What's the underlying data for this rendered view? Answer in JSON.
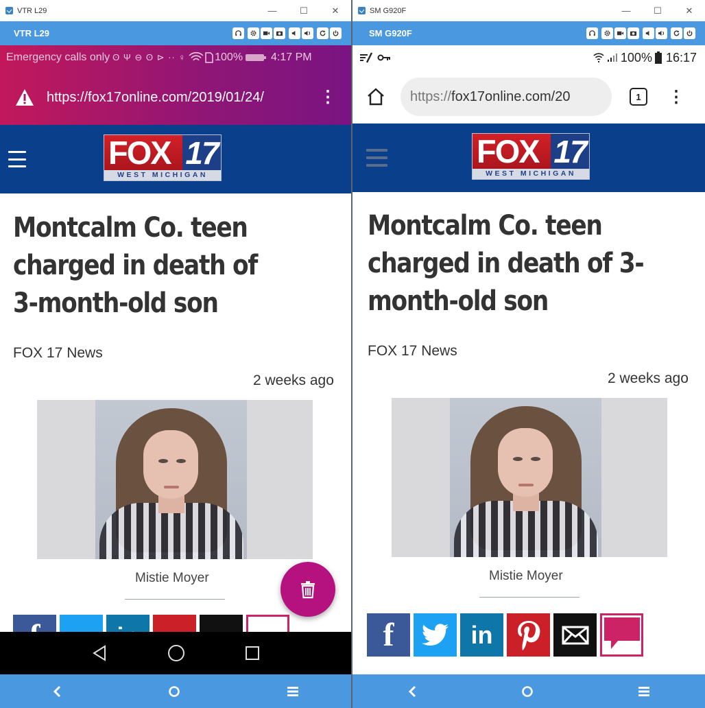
{
  "left": {
    "window_title": "VTR L29",
    "toolbar_title": "VTR L29",
    "status": {
      "text": "Emergency calls only",
      "icons_text": "ʘ Ψ ⊖ ʘ ⊳ ·· ♀",
      "battery": "100%",
      "time": "4:17 PM"
    },
    "url": "https://fox17online.com/2019/01/24/",
    "fab_icon": "delete-icon"
  },
  "right": {
    "window_title": "SM G920F",
    "toolbar_title": "SM G920F",
    "status": {
      "battery": "100%",
      "time": "16:17"
    },
    "url_scheme": "https://",
    "url_rest": "fox17online.com/20",
    "tab_count": "1"
  },
  "site": {
    "logo_text": "FOX",
    "logo_number": "17",
    "logo_sub": "WEST MICHIGAN"
  },
  "article": {
    "headline_left": [
      "Montcalm Co. teen",
      "charged in death of",
      "3-month-old son"
    ],
    "headline_right": [
      "Montcalm Co. teen",
      "charged in death of 3-",
      "month-old son"
    ],
    "byline": "FOX 17 News",
    "time_ago": "2 weeks ago",
    "photo_caption": "Mistie Moyer"
  },
  "share_icons": [
    "facebook-icon",
    "twitter-icon",
    "linkedin-icon",
    "pinterest-icon",
    "email-icon",
    "comment-icon"
  ],
  "share_labels": {
    "facebook": "f",
    "linkedin": "in"
  },
  "window_controls": {
    "minimize": "—",
    "maximize": "☐",
    "close": "✕"
  },
  "colors": {
    "toolbar_blue": "#4a98e0",
    "status_magenta": "#c2185b",
    "site_header_blue": "#0a3f8c",
    "fab": "#b5127f"
  }
}
